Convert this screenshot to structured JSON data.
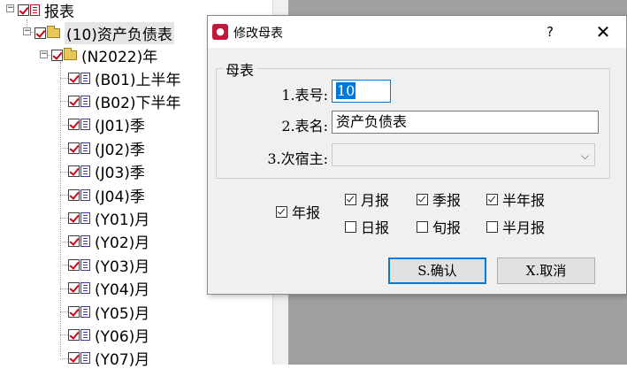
{
  "tree": {
    "root": "报表",
    "level1": "(10)资产负债表",
    "level2": "(N2022)年",
    "items": [
      "(B01)上半年",
      "(B02)下半年",
      "(J01)季",
      "(J02)季",
      "(J03)季",
      "(J04)季",
      "(Y01)月",
      "(Y02)月",
      "(Y03)月",
      "(Y04)月",
      "(Y05)月",
      "(Y06)月",
      "(Y07)月"
    ]
  },
  "dialog": {
    "title": "修改母表",
    "help": "?",
    "close": "✕",
    "group_title": "母表",
    "field1_label": "1.表号:",
    "field1_value": "10",
    "field2_label": "2.表名:",
    "field2_value": "资产负债表",
    "field3_label": "3.次宿主:",
    "field3_value": "",
    "chk_year": "年报",
    "chk_month": "月报",
    "chk_quarter": "季报",
    "chk_halfyear": "半年报",
    "chk_day": "日报",
    "chk_tenday": "旬报",
    "chk_halfmonth": "半月报",
    "ok": "S.确认",
    "cancel": "X.取消"
  },
  "colors": {
    "check_red": "#d0001c",
    "focus_blue": "#0078d7",
    "app_icon": "#c4183a"
  }
}
